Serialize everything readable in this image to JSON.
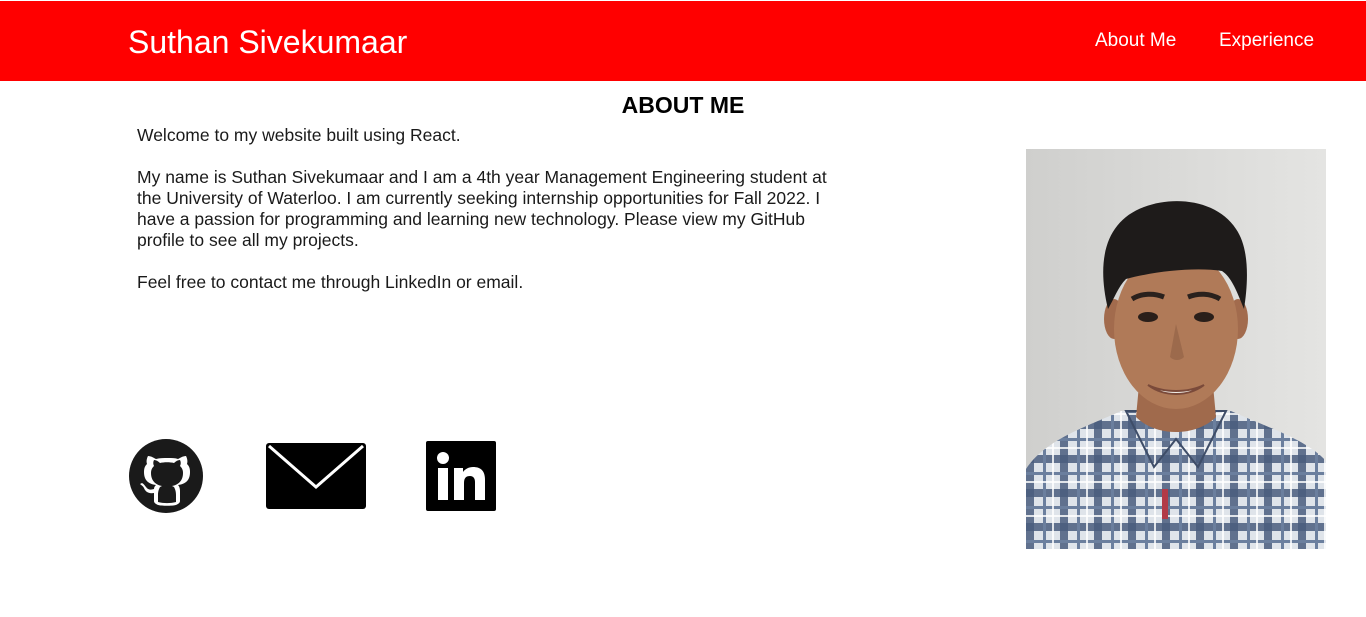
{
  "header": {
    "brand": "Suthan Sivekumaar",
    "nav": {
      "about": "About Me",
      "experience": "Experience"
    }
  },
  "about": {
    "title": "ABOUT ME",
    "paragraphs": [
      "Welcome to my website built using React.",
      "My name is Suthan Sivekumaar and I am a 4th year Management Engineering student at the University of Waterloo. I am currently seeking internship opportunities for Fall 2022. I have a passion for programming and learning new technology. Please view my GitHub profile to see all my projects.",
      "Feel free to contact me through LinkedIn or email."
    ]
  },
  "social": {
    "icons": [
      "github-icon",
      "email-icon",
      "linkedin-icon"
    ],
    "linkedin_glyph": "in"
  },
  "colors": {
    "header_bg": "#ff0000",
    "header_text": "#ffffff",
    "body_text": "#1a1a1a"
  }
}
